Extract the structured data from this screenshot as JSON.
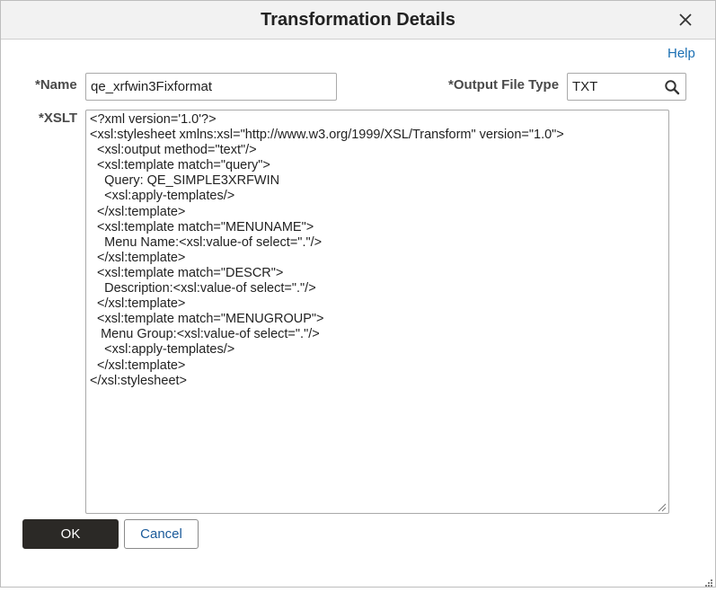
{
  "dialog": {
    "title": "Transformation Details",
    "close_icon": "close-icon",
    "help_label": "Help"
  },
  "form": {
    "name_label": "*Name",
    "name_value": "qe_xrfwin3Fixformat",
    "output_type_label": "*Output File Type",
    "output_type_value": "TXT",
    "lookup_icon": "search-icon",
    "xslt_label": "*XSLT",
    "xslt_value": "<?xml version='1.0'?>\n<xsl:stylesheet xmlns:xsl=\"http://www.w3.org/1999/XSL/Transform\" version=\"1.0\">\n  <xsl:output method=\"text\"/>\n  <xsl:template match=\"query\">\n    Query: QE_SIMPLE3XRFWIN\n    <xsl:apply-templates/>\n  </xsl:template>\n  <xsl:template match=\"MENUNAME\">\n    Menu Name:<xsl:value-of select=\".\"/>\n  </xsl:template>\n  <xsl:template match=\"DESCR\">\n    Description:<xsl:value-of select=\".\"/>\n  </xsl:template>\n  <xsl:template match=\"MENUGROUP\">\n   Menu Group:<xsl:value-of select=\".\"/>\n    <xsl:apply-templates/>\n  </xsl:template>\n</xsl:stylesheet>"
  },
  "buttons": {
    "ok_label": "OK",
    "cancel_label": "Cancel"
  },
  "colors": {
    "ok_background": "#2b2926",
    "link": "#1a6fb3",
    "header_background": "#f2f2f2"
  }
}
